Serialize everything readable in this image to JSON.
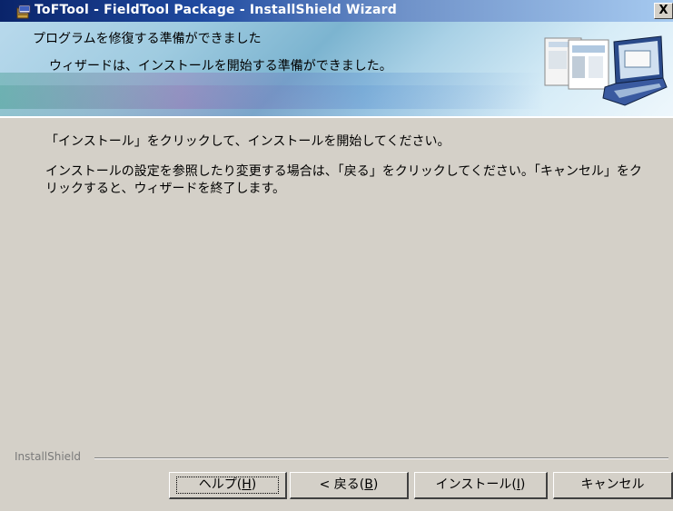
{
  "window": {
    "title": "ToFTool - FieldTool Package - InstallShield Wizard",
    "close_glyph": "X"
  },
  "banner": {
    "heading": "プログラムを修復する準備ができました",
    "subheading": "ウィザードは、インストールを開始する準備ができました。"
  },
  "content": {
    "instruction": "「インストール」をクリックして、インストールを開始してください。",
    "detail": "インストールの設定を参照したり変更する場合は、「戻る」をクリックしてください。「キャンセル」をクリックすると、ウィザードを終了します。"
  },
  "footer": {
    "brand": "InstallShield"
  },
  "buttons": {
    "help": {
      "label": "ヘルプ(",
      "key": "H",
      "suffix": ")"
    },
    "back": {
      "label": "< 戻る(",
      "key": "B",
      "suffix": ")"
    },
    "install": {
      "label": "インストール(",
      "key": "I",
      "suffix": ")"
    },
    "cancel": {
      "label": "キャンセル"
    }
  },
  "colors": {
    "titlebar_start": "#0a246a",
    "titlebar_end": "#a6caf0",
    "dialog_bg": "#d4d0c8"
  },
  "icons": {
    "app": "installer-icon",
    "banner_art": "laptop-icon"
  }
}
